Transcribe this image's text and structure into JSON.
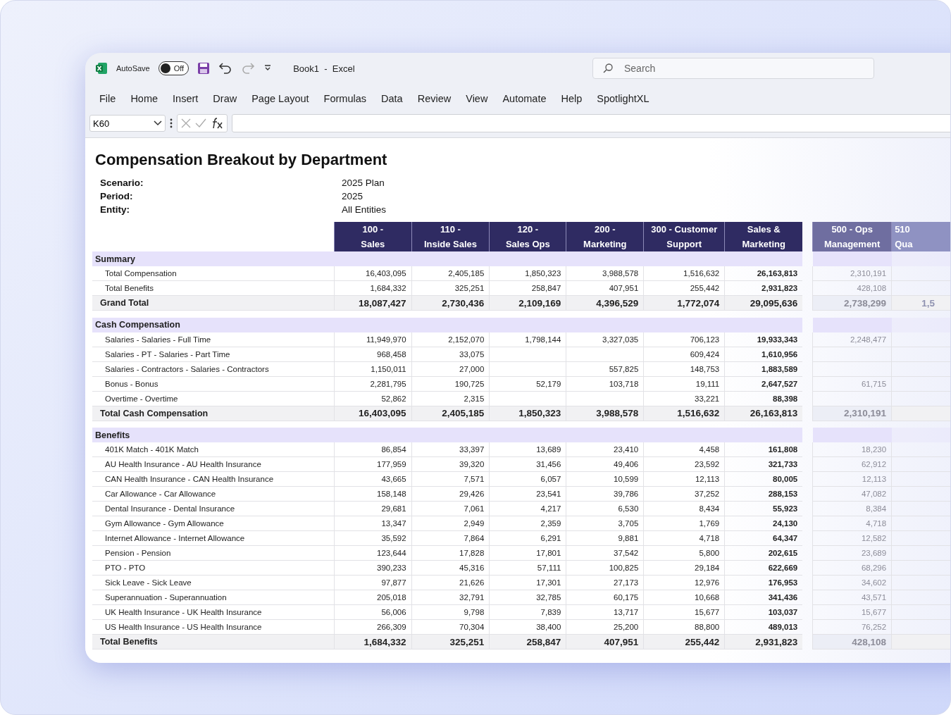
{
  "window": {
    "autosave_label": "AutoSave",
    "autosave": {
      "on": false,
      "label": "Off"
    },
    "title": "Book1  -  Excel",
    "search": {
      "placeholder": "Search"
    }
  },
  "menu": [
    {
      "label": "File"
    },
    {
      "label": "Home"
    },
    {
      "label": "Insert"
    },
    {
      "label": "Draw"
    },
    {
      "label": "Page Layout"
    },
    {
      "label": "Formulas"
    },
    {
      "label": "Data"
    },
    {
      "label": "Review"
    },
    {
      "label": "View"
    },
    {
      "label": "Automate"
    },
    {
      "label": "Help"
    },
    {
      "label": "SpotlightXL"
    }
  ],
  "formula_bar": {
    "name_box": "K60"
  },
  "sheet": {
    "title": "Compensation Breakout by Department",
    "params": [
      {
        "label": "Scenario:",
        "value": "2025 Plan"
      },
      {
        "label": "Period:",
        "value": "2025"
      },
      {
        "label": "Entity:",
        "value": "All Entities"
      }
    ],
    "columns": [
      {
        "line1": "100 -",
        "line2": "Sales",
        "kind": "dept"
      },
      {
        "line1": "110 -",
        "line2": "Inside Sales",
        "kind": "dept"
      },
      {
        "line1": "120 -",
        "line2": "Sales Ops",
        "kind": "dept"
      },
      {
        "line1": "200 -",
        "line2": "Marketing",
        "kind": "dept"
      },
      {
        "line1": "300 - Customer",
        "line2": "Support",
        "kind": "dept"
      },
      {
        "line1": "Sales &",
        "line2": "Marketing",
        "kind": "subtotal"
      },
      {
        "line1": "500 - Ops",
        "line2": "Management",
        "kind": "faded"
      },
      {
        "line1": "510",
        "line2": "Qua",
        "kind": "cut"
      }
    ],
    "sections": [
      {
        "title": "Summary",
        "rows": [
          {
            "label": "Total Compensation",
            "kind": "item",
            "values": {
              "col_1": "16,403,095",
              "col_2": "2,405,185",
              "col_3": "1,850,323",
              "col_4": "3,988,578",
              "col_5": "1,516,632",
              "col_6": "26,163,813",
              "col_7": "2,310,191"
            }
          },
          {
            "label": "Total Benefits",
            "kind": "item",
            "values": {
              "col_1": "1,684,332",
              "col_2": "325,251",
              "col_3": "258,847",
              "col_4": "407,951",
              "col_5": "255,442",
              "col_6": "2,931,823",
              "col_7": "428,108"
            }
          },
          {
            "label": "Grand Total",
            "kind": "total",
            "values": {
              "col_1": "18,087,427",
              "col_2": "2,730,436",
              "col_3": "2,109,169",
              "col_4": "4,396,529",
              "col_5": "1,772,074",
              "col_6": "29,095,636",
              "col_7": "2,738,299",
              "col_8": "1,5"
            }
          }
        ]
      },
      {
        "title": "Cash Compensation",
        "rows": [
          {
            "label": "Salaries - Salaries - Full Time",
            "kind": "item",
            "values": {
              "col_1": "11,949,970",
              "col_2": "2,152,070",
              "col_3": "1,798,144",
              "col_4": "3,327,035",
              "col_5": "706,123",
              "col_6": "19,933,343",
              "col_7": "2,248,477"
            }
          },
          {
            "label": "Salaries - PT - Salaries - Part Time",
            "kind": "item",
            "values": {
              "col_1": "968,458",
              "col_2": "33,075",
              "col_5": "609,424",
              "col_6": "1,610,956"
            }
          },
          {
            "label": "Salaries - Contractors - Salaries - Contractors",
            "kind": "item",
            "values": {
              "col_1": "1,150,011",
              "col_2": "27,000",
              "col_4": "557,825",
              "col_5": "148,753",
              "col_6": "1,883,589"
            }
          },
          {
            "label": "Bonus - Bonus",
            "kind": "item",
            "values": {
              "col_1": "2,281,795",
              "col_2": "190,725",
              "col_3": "52,179",
              "col_4": "103,718",
              "col_5": "19,111",
              "col_6": "2,647,527",
              "col_7": "61,715"
            }
          },
          {
            "label": "Overtime - Overtime",
            "kind": "item",
            "values": {
              "col_1": "52,862",
              "col_2": "2,315",
              "col_5": "33,221",
              "col_6": "88,398"
            }
          },
          {
            "label": "Total Cash Compensation",
            "kind": "total",
            "values": {
              "col_1": "16,403,095",
              "col_2": "2,405,185",
              "col_3": "1,850,323",
              "col_4": "3,988,578",
              "col_5": "1,516,632",
              "col_6": "26,163,813",
              "col_7": "2,310,191"
            }
          }
        ]
      },
      {
        "title": "Benefits",
        "rows": [
          {
            "label": "401K Match - 401K Match",
            "kind": "item",
            "values": {
              "col_1": "86,854",
              "col_2": "33,397",
              "col_3": "13,689",
              "col_4": "23,410",
              "col_5": "4,458",
              "col_6": "161,808",
              "col_7": "18,230"
            }
          },
          {
            "label": "AU Health Insurance - AU Health Insurance",
            "kind": "item",
            "values": {
              "col_1": "177,959",
              "col_2": "39,320",
              "col_3": "31,456",
              "col_4": "49,406",
              "col_5": "23,592",
              "col_6": "321,733",
              "col_7": "62,912"
            }
          },
          {
            "label": "CAN Health Insurance - CAN Health Insurance",
            "kind": "item",
            "values": {
              "col_1": "43,665",
              "col_2": "7,571",
              "col_3": "6,057",
              "col_4": "10,599",
              "col_5": "12,113",
              "col_6": "80,005",
              "col_7": "12,113"
            }
          },
          {
            "label": "Car Allowance - Car Allowance",
            "kind": "item",
            "values": {
              "col_1": "158,148",
              "col_2": "29,426",
              "col_3": "23,541",
              "col_4": "39,786",
              "col_5": "37,252",
              "col_6": "288,153",
              "col_7": "47,082"
            }
          },
          {
            "label": "Dental Insurance - Dental Insurance",
            "kind": "item",
            "values": {
              "col_1": "29,681",
              "col_2": "7,061",
              "col_3": "4,217",
              "col_4": "6,530",
              "col_5": "8,434",
              "col_6": "55,923",
              "col_7": "8,384"
            }
          },
          {
            "label": "Gym Allowance - Gym Allowance",
            "kind": "item",
            "values": {
              "col_1": "13,347",
              "col_2": "2,949",
              "col_3": "2,359",
              "col_4": "3,705",
              "col_5": "1,769",
              "col_6": "24,130",
              "col_7": "4,718"
            }
          },
          {
            "label": "Internet Allowance - Internet Allowance",
            "kind": "item",
            "values": {
              "col_1": "35,592",
              "col_2": "7,864",
              "col_3": "6,291",
              "col_4": "9,881",
              "col_5": "4,718",
              "col_6": "64,347",
              "col_7": "12,582"
            }
          },
          {
            "label": "Pension - Pension",
            "kind": "item",
            "values": {
              "col_1": "123,644",
              "col_2": "17,828",
              "col_3": "17,801",
              "col_4": "37,542",
              "col_5": "5,800",
              "col_6": "202,615",
              "col_7": "23,689"
            }
          },
          {
            "label": "PTO - PTO",
            "kind": "item",
            "values": {
              "col_1": "390,233",
              "col_2": "45,316",
              "col_3": "57,111",
              "col_4": "100,825",
              "col_5": "29,184",
              "col_6": "622,669",
              "col_7": "68,296"
            }
          },
          {
            "label": "Sick Leave - Sick Leave",
            "kind": "item",
            "values": {
              "col_1": "97,877",
              "col_2": "21,626",
              "col_3": "17,301",
              "col_4": "27,173",
              "col_5": "12,976",
              "col_6": "176,953",
              "col_7": "34,602"
            }
          },
          {
            "label": "Superannuation - Superannuation",
            "kind": "item",
            "values": {
              "col_1": "205,018",
              "col_2": "32,791",
              "col_3": "32,785",
              "col_4": "60,175",
              "col_5": "10,668",
              "col_6": "341,436",
              "col_7": "43,571"
            }
          },
          {
            "label": "UK Health Insurance - UK Health Insurance",
            "kind": "item",
            "values": {
              "col_1": "56,006",
              "col_2": "9,798",
              "col_3": "7,839",
              "col_4": "13,717",
              "col_5": "15,677",
              "col_6": "103,037",
              "col_7": "15,677"
            }
          },
          {
            "label": "US Health Insurance - US Health Insurance",
            "kind": "item",
            "values": {
              "col_1": "266,309",
              "col_2": "70,304",
              "col_3": "38,400",
              "col_4": "25,200",
              "col_5": "88,800",
              "col_6": "489,013",
              "col_7": "76,252"
            }
          },
          {
            "label": "Total Benefits",
            "kind": "total",
            "values": {
              "col_1": "1,684,332",
              "col_2": "325,251",
              "col_3": "258,847",
              "col_4": "407,951",
              "col_5": "255,442",
              "col_6": "2,931,823",
              "col_7": "428,108"
            }
          }
        ]
      }
    ]
  }
}
